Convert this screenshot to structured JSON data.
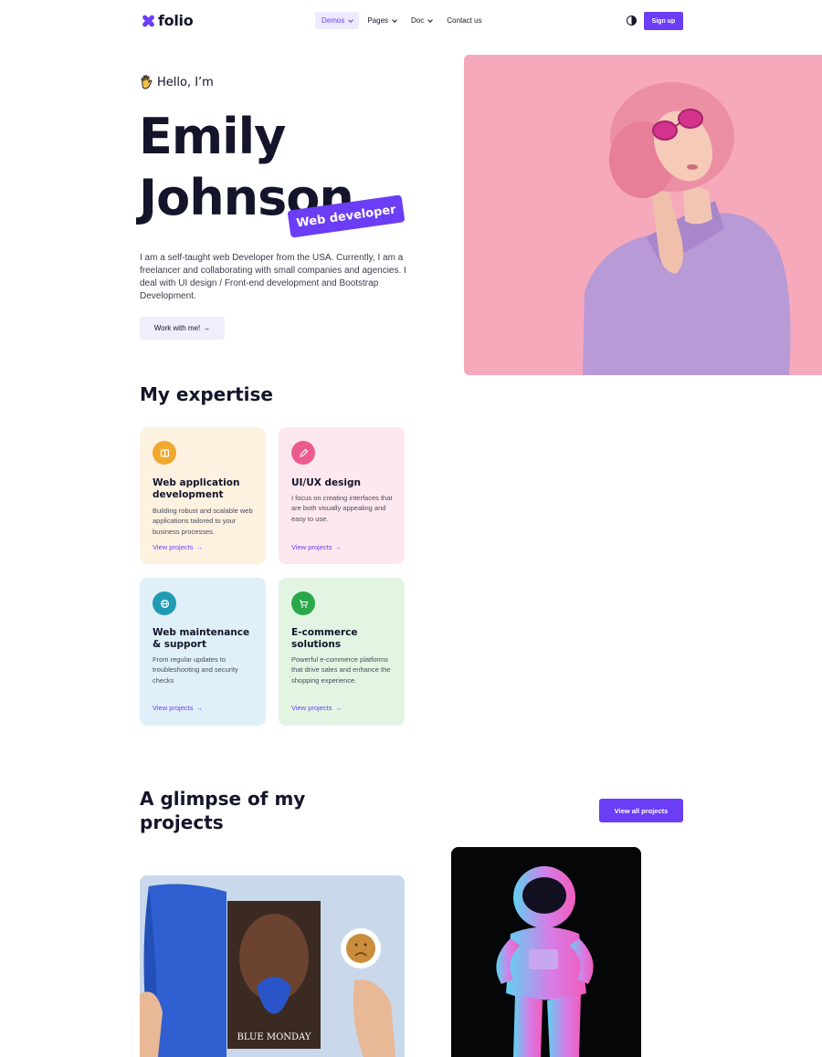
{
  "nav": {
    "logo": "folio",
    "items": [
      {
        "label": "Demos",
        "active": true
      },
      {
        "label": "Pages",
        "active": false
      },
      {
        "label": "Doc",
        "active": false
      },
      {
        "label": "Contact us",
        "active": false
      }
    ],
    "signup": "Sign up"
  },
  "hero": {
    "greeting": "Hello, I’m",
    "first_name": "Emily",
    "last_name": "Johnson",
    "role": "Web developer",
    "bio": "I am a self-taught web Developer from the USA. Currently, I am a freelancer and collaborating with small companies and agencies. I deal with UI design / Front-end development and Bootstrap Development.",
    "cta": "Work with me!",
    "arrow": "→"
  },
  "expertise": {
    "title": "My expertise",
    "cards": [
      {
        "title": "Web application development",
        "text": "Building robust and scalable web applications tailored to your business processes.",
        "link": "View projects",
        "bg": "#fdf1e0",
        "icon_color": "#f0a92f",
        "icon": "book-icon"
      },
      {
        "title": "UI/UX design",
        "text": "I focus on creating interfaces that are both visually appealing and easy to use.",
        "link": "View projects",
        "bg": "#fde8ef",
        "icon_color": "#ec5b8f",
        "icon": "pen-icon"
      },
      {
        "title": "Web maintenance & support",
        "text": "From regular updates to troubleshooting and security checks",
        "link": "View projects",
        "bg": "#dff0f8",
        "icon_color": "#1f9bb3",
        "icon": "globe-icon"
      },
      {
        "title": "E-commerce solutions",
        "text": "Powerful e-commerce platforms that drive sales and enhance the shopping experience.",
        "link": "View projects",
        "bg": "#e2f5e3",
        "icon_color": "#2aa84a",
        "icon": "cart-icon"
      }
    ]
  },
  "projects": {
    "title": "A glimpse of my projects",
    "view_all": "View all projects",
    "magazine_caption": "BLUE MONDAY"
  },
  "colors": {
    "accent": "#6b3df5",
    "hero_pink": "#f6a9bb"
  }
}
